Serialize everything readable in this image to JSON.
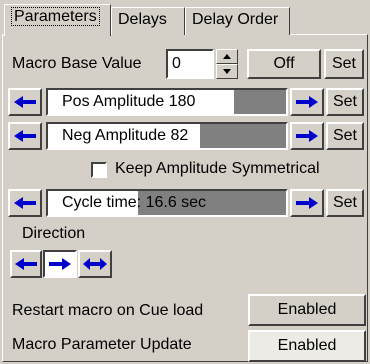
{
  "tabs": [
    {
      "label": "Parameters"
    },
    {
      "label": "Delays"
    },
    {
      "label": "Delay Order"
    }
  ],
  "macro_base": {
    "label": "Macro Base Value",
    "value": "0",
    "off_label": "Off",
    "set_label": "Set"
  },
  "pos_amplitude": {
    "label": "Pos Amplitude 180",
    "fill": 0.78,
    "set_label": "Set"
  },
  "neg_amplitude": {
    "label": "Neg Amplitude 82",
    "fill": 0.64,
    "set_label": "Set"
  },
  "keep_symmetrical": {
    "label": "Keep Amplitude Symmetrical",
    "checked": false
  },
  "cycle_time": {
    "label": "Cycle time: 16.6 sec",
    "fill": 0.38,
    "set_label": "Set"
  },
  "direction": {
    "label": "Direction"
  },
  "restart_macro": {
    "label": "Restart macro on Cue load",
    "value": "Enabled"
  },
  "param_update": {
    "label": "Macro Parameter Update",
    "value": "Enabled"
  },
  "colors": {
    "arrow": "#0000cc",
    "face": "#d4d0c8",
    "bar_track": "#808080"
  }
}
